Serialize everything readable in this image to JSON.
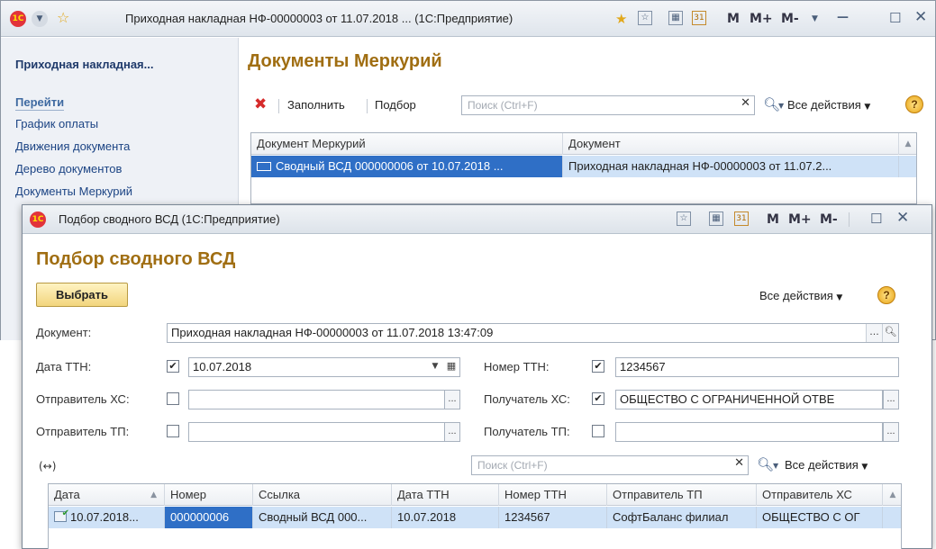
{
  "back_window": {
    "title": "Приходная накладная НФ-00000003 от 11.07.2018 ... (1С:Предприятие)",
    "logo": "1С",
    "controls": {
      "memo_m": "M",
      "memo_mplus": "M+",
      "memo_mminus": "M-"
    },
    "sidebar": {
      "doc_title": "Приходная накладная...",
      "go_heading": "Перейти",
      "items": [
        "График оплаты",
        "Движения документа",
        "Дерево документов",
        "Документы Меркурий"
      ]
    },
    "main": {
      "title": "Документы Меркурий",
      "toolbar": {
        "fill": "Заполнить",
        "select": "Подбор",
        "search_placeholder": "Поиск (Ctrl+F)",
        "all_actions": "Все действия"
      },
      "table": {
        "columns": [
          "Документ Меркурий",
          "Документ"
        ],
        "rows": [
          [
            "Сводный ВСД 000000006 от 10.07.2018 ...",
            "Приходная накладная НФ-00000003 от 11.07.2..."
          ]
        ]
      }
    }
  },
  "dialog": {
    "title": "Подбор сводного ВСД  (1С:Предприятие)",
    "form_title": "Подбор сводного ВСД",
    "choose_button": "Выбрать",
    "all_actions": "Все действия",
    "fields": {
      "document_label": "Документ:",
      "document_value": "Приходная накладная НФ-00000003 от 11.07.2018 13:47:09",
      "date_ttn_label": "Дата ТТН:",
      "date_ttn_value": "10.07.2018",
      "num_ttn_label": "Номер ТТН:",
      "num_ttn_value": "1234567",
      "sender_hs_label": "Отправитель ХС:",
      "sender_hs_value": "",
      "receiver_hs_label": "Получатель ХС:",
      "receiver_hs_value": "ОБЩЕСТВО С ОГРАНИЧЕННОЙ ОТВЕ",
      "sender_tp_label": "Отправитель ТП:",
      "sender_tp_value": "",
      "receiver_tp_label": "Получатель ТП:",
      "receiver_tp_value": ""
    },
    "checks": {
      "date_ttn": true,
      "num_ttn": true,
      "sender_hs": false,
      "receiver_hs": true,
      "sender_tp": false,
      "receiver_tp": false
    },
    "list_toolbar": {
      "arrows": "(↔)",
      "search_placeholder": "Поиск (Ctrl+F)",
      "all_actions": "Все действия"
    },
    "table": {
      "columns": [
        "Дата",
        "Номер",
        "Ссылка",
        "Дата ТТН",
        "Номер ТТН",
        "Отправитель ТП",
        "Отправитель ХС"
      ],
      "rows": [
        [
          "10.07.2018...",
          "000000006",
          "Сводный ВСД 000...",
          "10.07.2018",
          "1234567",
          "СофтБаланс филиал",
          "ОБЩЕСТВО С ОГ"
        ]
      ]
    }
  },
  "colors": {
    "accent_title": "#a06e12",
    "selection": "#cfe2f7",
    "link": "#1c4484"
  }
}
